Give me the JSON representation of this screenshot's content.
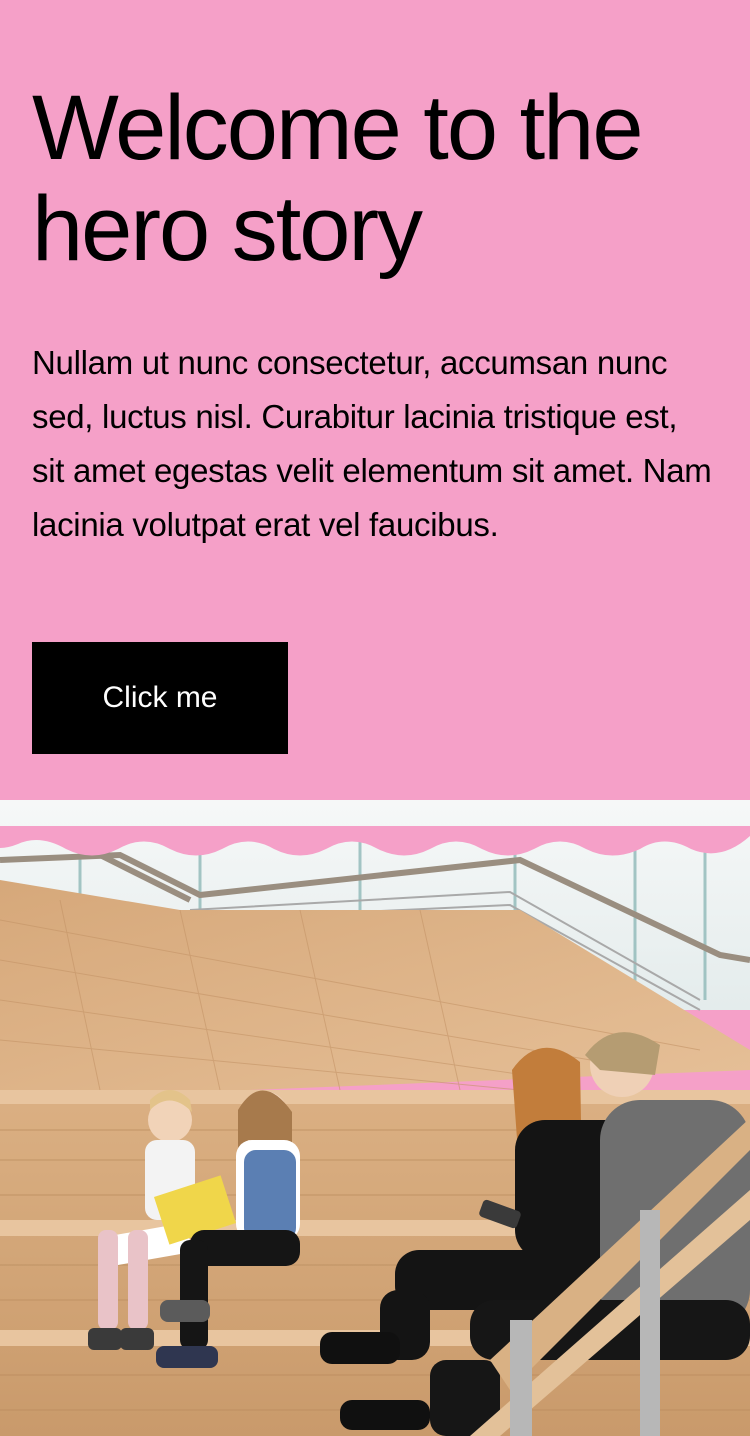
{
  "hero": {
    "title": "Welcome to the hero story",
    "description": "Nullam ut nunc consectetur, accumsan nunc sed, luctus nisl. Curabitur lacinia tristique est, sit amet egestas velit elementum sit amet. Nam lacinia volutpat erat vel faucibus.",
    "button_label": "Click me"
  },
  "colors": {
    "background": "#f5a0c8",
    "button": "#000000",
    "button_text": "#ffffff",
    "text": "#000000"
  }
}
